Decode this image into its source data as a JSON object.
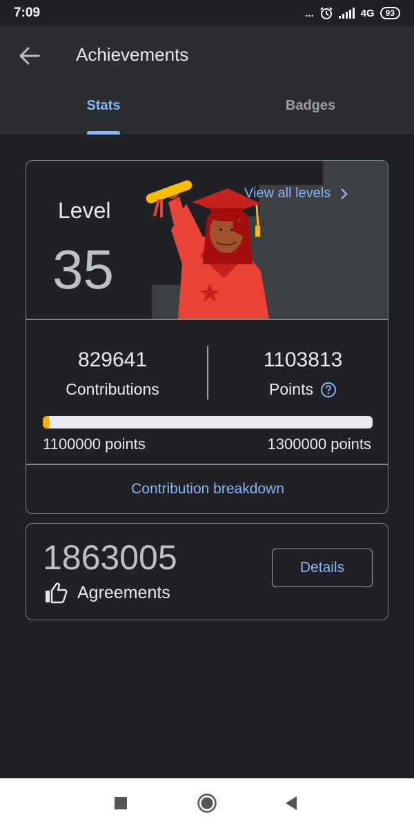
{
  "status_bar": {
    "time": "7:09",
    "dots": "...",
    "network": "4G",
    "battery": "93"
  },
  "header": {
    "title": "Achievements"
  },
  "tabs": [
    {
      "label": "Stats",
      "active": true
    },
    {
      "label": "Badges",
      "active": false
    }
  ],
  "level_card": {
    "level_label": "Level",
    "level_value": "35",
    "view_all_label": "View all levels",
    "contributions": {
      "value": "829641",
      "label": "Contributions"
    },
    "points": {
      "value": "1103813",
      "label": "Points"
    },
    "progress": {
      "fraction": 0.0191,
      "min_label": "1100000 points",
      "max_label": "1300000 points"
    },
    "breakdown_label": "Contribution breakdown"
  },
  "agreements_card": {
    "count": "1863005",
    "label": "Agreements",
    "details_label": "Details"
  },
  "colors": {
    "accent": "#8ab4f8",
    "background": "#202124",
    "progress": "#f9ab00",
    "illustration_red": "#ea4335"
  }
}
